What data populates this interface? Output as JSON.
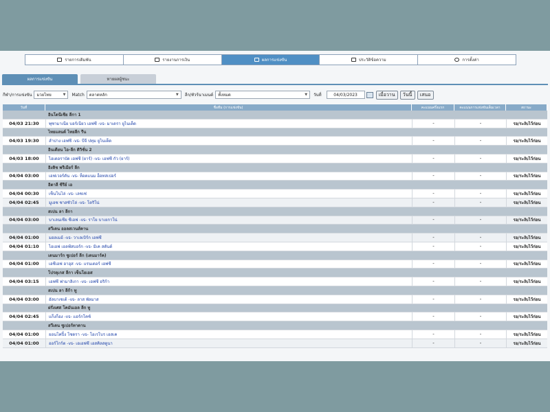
{
  "nav": [
    {
      "label": "รายการเดิมพัน",
      "icon": "list-icon",
      "active": false
    },
    {
      "label": "รายงานการเงิน",
      "icon": "report-icon",
      "active": false
    },
    {
      "label": "ผลการแข่งขัน",
      "icon": "results-icon",
      "active": true
    },
    {
      "label": "ประวัติข้อความ",
      "icon": "mail-icon",
      "active": false
    },
    {
      "label": "การตั้งค่า",
      "icon": "gear-icon",
      "active": false
    }
  ],
  "tabs": [
    "ผลการแข่งขัน",
    "ทายผลผู้ชนะ"
  ],
  "filters": {
    "sport_label": "กีฬา/การแข่งขัน",
    "sport_value": "มวยไทย",
    "match_label": "Match",
    "match_value": "ตลาดหลัก",
    "league_label": "ลีก/ทัวร์นาเมนต์",
    "league_value": "ทั้งหมด",
    "date_label": "วันที่",
    "date_value": "04/03/2023",
    "btn_yesterday": "เมื่อวาน",
    "btn_today": "วันนี้",
    "btn_submit": "เสนอ"
  },
  "table": {
    "headers": [
      "วันที่",
      "ชื่อทีม (การแข่งขัน)",
      "คะแนนครึ่งแรก",
      "คะแนนการแข่งขันเต็มเวลา",
      "สถานะ"
    ],
    "rows": [
      {
        "type": "league",
        "name": "อินโดนีเซีย ลีกา 1"
      },
      {
        "type": "match",
        "time": "04/03 21:30",
        "teams": "พุซามาเนีย บอร์เนียว เอฟซี -vs- มาเดรา ยูไนเต็ด",
        "s1": "-",
        "s2": "-",
        "status": "รอ/ระงับไว้ก่อน"
      },
      {
        "type": "league",
        "name": "ไทยแลนด์ ไทยลีก รีน"
      },
      {
        "type": "match",
        "time": "04/03 19:30",
        "teams": "ลำปาง เอฟซี -vs- บีจี ปทุม ยูไนเต็ด",
        "s1": "-",
        "s2": "-",
        "status": "รอ/ระงับไว้ก่อน"
      },
      {
        "type": "league",
        "name": "อินเดียน ไอ-ลีก ดิวิชั่น 2"
      },
      {
        "type": "match",
        "time": "04/03 18:00",
        "teams": "ไฮเดอราบัด เอฟซี (ยาร์) -vs- เอฟซี กัว (ยาร์)",
        "s1": "-",
        "s2": "-",
        "status": "รอ/ระงับไว้ก่อน"
      },
      {
        "type": "league",
        "name": "อิงลิช พรีเมียร์ ลีก"
      },
      {
        "type": "match",
        "time": "04/04 03:00",
        "teams": "เอฟเวอร์ตัน -vs- ท็อตแนม ฮ็อทสเปอร์",
        "s1": "-",
        "s2": "-",
        "status": "รอ/ระงับไว้ก่อน"
      },
      {
        "type": "league",
        "name": "อิตาลี ซีรีย์ เอ"
      },
      {
        "type": "match",
        "time": "04/04 00:30",
        "teams": "เซ็นโนไล่ -vs- เลชเซ่",
        "s1": "-",
        "s2": "-",
        "status": "รอ/ระงับไว้ก่อน"
      },
      {
        "type": "match",
        "time": "04/04 02:45",
        "teams": "มูเอซ ซาสซัวโล่ -vs- โตริโน่",
        "s1": "-",
        "s2": "-",
        "status": "รอ/ระงับไว้ก่อน"
      },
      {
        "type": "league",
        "name": "สเปน ลา ลีกา"
      },
      {
        "type": "match",
        "time": "04/04 03:00",
        "teams": "บาเลนเซีย ซีเอฟ -vs- ราโย บาเยกาโน่",
        "s1": "-",
        "s2": "-",
        "status": "รอ/ระงับไว้ก่อน"
      },
      {
        "type": "league",
        "name": "สวีเดน ออลสเวนส์คาน"
      },
      {
        "type": "match",
        "time": "04/04 01:00",
        "teams": "มอลเมอ้ -vs- วาเลเบิร์ก เอฟซี",
        "s1": "-",
        "s2": "-",
        "status": "รอ/ระงับไว้ก่อน"
      },
      {
        "type": "match",
        "time": "04/04 01:10",
        "teams": "ไอเอฟ เอลฟ์สบอร์ก -vs- มิเค สตันด์",
        "s1": "-",
        "s2": "-",
        "status": "รอ/ระงับไว้ก่อน"
      },
      {
        "type": "league",
        "name": "เดนมาร์ก ซูเปอร์ ลีก (เดนมาร์ค)"
      },
      {
        "type": "match",
        "time": "04/04 01:00",
        "teams": "เอซีเอฟ อาฮุส -vs- แรนเดอร์ เอฟซี",
        "s1": "-",
        "s2": "-",
        "status": "รอ/ระงับไว้ก่อน"
      },
      {
        "type": "league",
        "name": "โปรตุเกส ลีกา เซ็นโยเอส"
      },
      {
        "type": "match",
        "time": "04/04 03:15",
        "teams": "เอฟซี ฟามาลิเกา -vs- เอฟซี อริก้า",
        "s1": "-",
        "s2": "-",
        "status": "รอ/ระงับไว้ก่อน"
      },
      {
        "type": "league",
        "name": "สเปน ลา ลีก้า ทู"
      },
      {
        "type": "match",
        "time": "04/04 03:00",
        "teams": "อัลบาเซเต้ -vs- ลาส พัลมาส",
        "s1": "-",
        "s2": "-",
        "status": "รอ/ระงับไว้ก่อน"
      },
      {
        "type": "league",
        "name": "ฝรั่งเศส โคมันเอล ลีก ทู"
      },
      {
        "type": "match",
        "time": "04/04 02:45",
        "teams": "แก็งก็อง -vs- แอร์กโคซ์",
        "s1": "-",
        "s2": "-",
        "status": "รอ/ระงับไว้ก่อน"
      },
      {
        "type": "league",
        "name": "สวีเดน ซูเปอร์ทาดาน"
      },
      {
        "type": "match",
        "time": "04/04 01:00",
        "teams": "ยอนโคปิ้ง โซดรา -vs- โอเรโบร เอสเค",
        "s1": "-",
        "s2": "-",
        "status": "รอ/ระงับไว้ก่อน"
      },
      {
        "type": "match",
        "time": "04/04 01:00",
        "teams": "ออร์โกร์ต -vs- เอเอฟซี เอสคิลสตูนา",
        "s1": "-",
        "s2": "-",
        "status": "รอ/ระงับไว้ก่อน"
      }
    ]
  }
}
